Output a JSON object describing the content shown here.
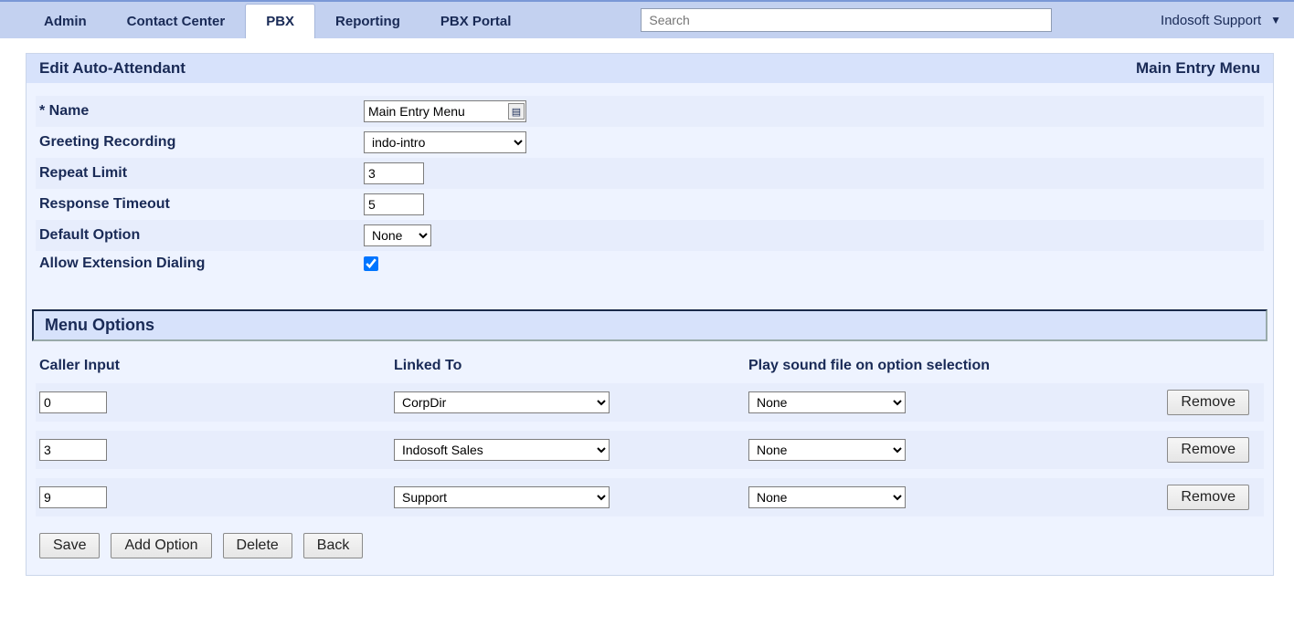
{
  "topnav": {
    "tabs": [
      {
        "label": "Admin",
        "active": false
      },
      {
        "label": "Contact Center",
        "active": false
      },
      {
        "label": "PBX",
        "active": true
      },
      {
        "label": "Reporting",
        "active": false
      },
      {
        "label": "PBX Portal",
        "active": false
      }
    ],
    "search_placeholder": "Search",
    "user_label": "Indosoft Support"
  },
  "panel": {
    "title": "Edit Auto-Attendant",
    "subtitle": "Main Entry Menu"
  },
  "form": {
    "name_label": "* Name",
    "name_value": "Main Entry Menu",
    "greeting_label": "Greeting Recording",
    "greeting_value": "indo-intro",
    "repeat_label": "Repeat Limit",
    "repeat_value": "3",
    "timeout_label": "Response Timeout",
    "timeout_value": "5",
    "default_label": "Default Option",
    "default_value": "None",
    "allow_ext_label": "Allow Extension Dialing",
    "allow_ext_checked": true
  },
  "menu_options": {
    "section_title": "Menu Options",
    "headers": {
      "caller_input": "Caller Input",
      "linked_to": "Linked To",
      "play_sound": "Play sound file on option selection"
    },
    "rows": [
      {
        "input": "0",
        "linked": "CorpDir",
        "sound": "None",
        "remove": "Remove"
      },
      {
        "input": "3",
        "linked": "Indosoft Sales",
        "sound": "None",
        "remove": "Remove"
      },
      {
        "input": "9",
        "linked": "Support",
        "sound": "None",
        "remove": "Remove"
      }
    ]
  },
  "actions": {
    "save": "Save",
    "add_option": "Add Option",
    "delete": "Delete",
    "back": "Back"
  }
}
